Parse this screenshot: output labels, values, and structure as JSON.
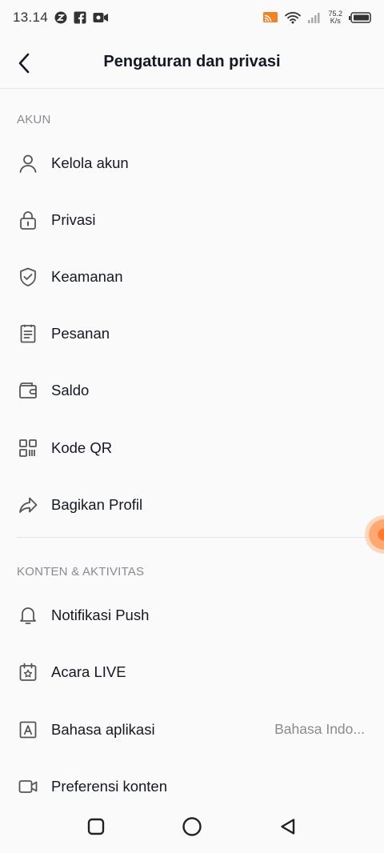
{
  "status_bar": {
    "time": "13.14",
    "speed_value": "75.2",
    "speed_unit": "K/s",
    "icons": [
      "z-app-icon",
      "facebook-icon",
      "video-camera-icon",
      "cast-icon",
      "wifi-icon",
      "signal-icon",
      "battery-icon"
    ]
  },
  "header": {
    "title": "Pengaturan dan privasi",
    "back_icon": "chevron-left-icon"
  },
  "sections": {
    "account": {
      "label": "AKUN",
      "items": [
        {
          "label": "Kelola akun",
          "icon": "person-icon"
        },
        {
          "label": "Privasi",
          "icon": "lock-icon"
        },
        {
          "label": "Keamanan",
          "icon": "shield-check-icon"
        },
        {
          "label": "Pesanan",
          "icon": "receipt-icon"
        },
        {
          "label": "Saldo",
          "icon": "wallet-icon"
        },
        {
          "label": "Kode QR",
          "icon": "qr-code-icon"
        },
        {
          "label": "Bagikan Profil",
          "icon": "share-icon"
        }
      ]
    },
    "content": {
      "label": "KONTEN & AKTIVITAS",
      "items": [
        {
          "label": "Notifikasi Push",
          "icon": "bell-icon"
        },
        {
          "label": "Acara LIVE",
          "icon": "calendar-star-icon"
        },
        {
          "label": "Bahasa aplikasi",
          "icon": "language-icon",
          "value": "Bahasa Indo..."
        },
        {
          "label": "Preferensi konten",
          "icon": "video-icon"
        }
      ]
    }
  },
  "nav_bar": {
    "icons": [
      "recent-apps-icon",
      "home-icon",
      "back-triangle-icon"
    ]
  },
  "colors": {
    "text": "#161823",
    "secondary_text": "#8a8b91",
    "background": "#fafafa",
    "floating_accent": "#ff7a2e"
  }
}
